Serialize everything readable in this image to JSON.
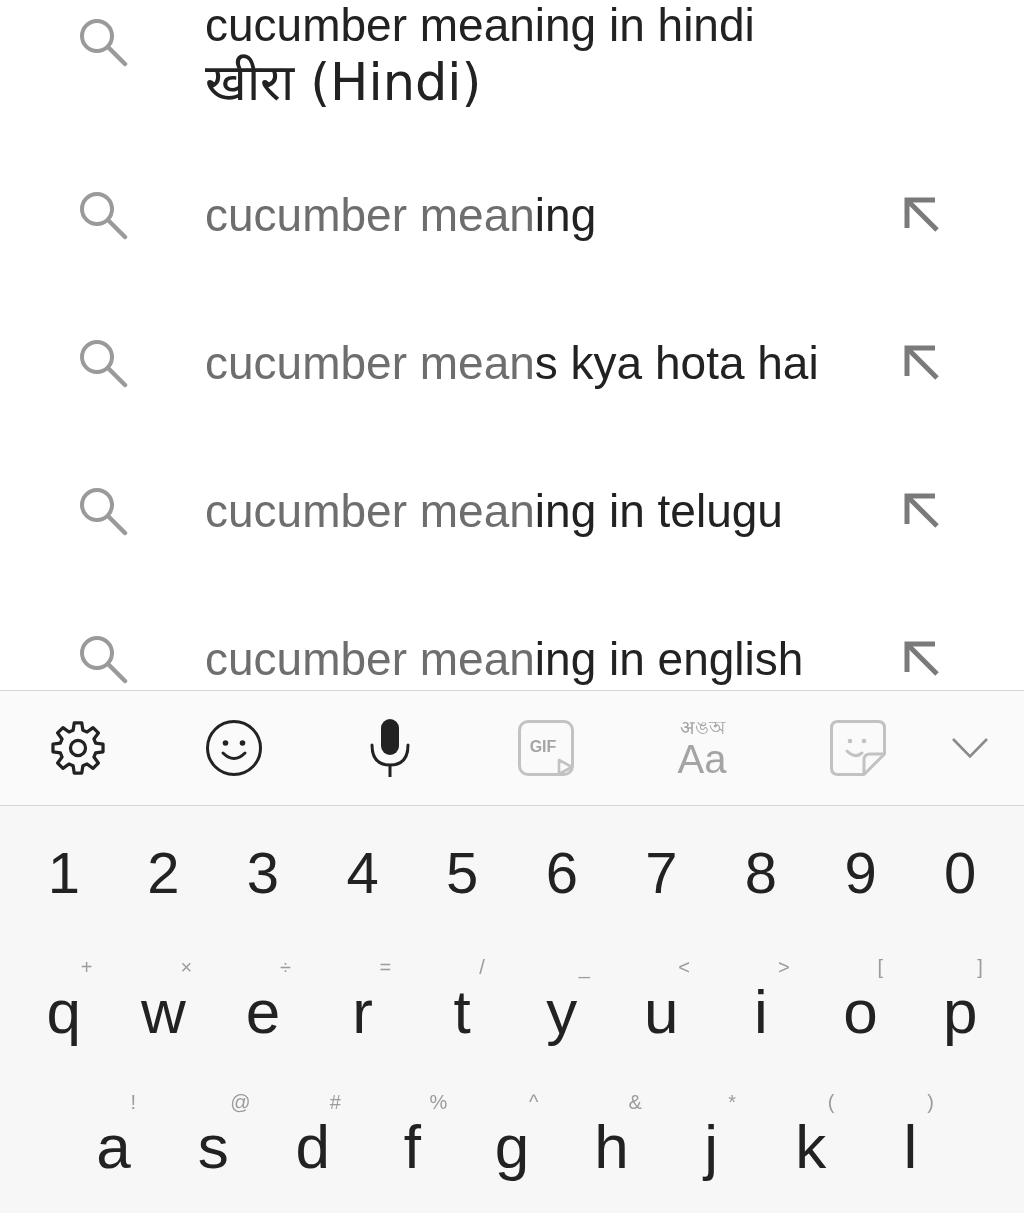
{
  "suggestions": [
    {
      "kind": "answer",
      "lines": [
        "cucumber meaning in hindi",
        "खीरा (Hindi)"
      ]
    },
    {
      "kind": "query",
      "typed": "cucumber mean",
      "completion": "ing"
    },
    {
      "kind": "query",
      "typed": "cucumber mean",
      "completion": "s kya hota hai"
    },
    {
      "kind": "query",
      "typed": "cucumber mean",
      "completion": "ing in telugu"
    },
    {
      "kind": "query",
      "typed": "cucumber mean",
      "completion": "ing in english"
    }
  ],
  "toolbar": [
    {
      "kind": "settings",
      "disabled": false
    },
    {
      "kind": "emoji",
      "disabled": false
    },
    {
      "kind": "voice",
      "disabled": false
    },
    {
      "kind": "gif",
      "label": "GIF",
      "disabled": true
    },
    {
      "kind": "script",
      "script": "अঙঅ",
      "label": "Aa",
      "disabled": true
    },
    {
      "kind": "sticker",
      "disabled": true
    },
    {
      "kind": "collapse",
      "disabled": false
    }
  ],
  "keyboard": {
    "rows": [
      {
        "keys": [
          {
            "label": "1"
          },
          {
            "label": "2"
          },
          {
            "label": "3"
          },
          {
            "label": "4"
          },
          {
            "label": "5"
          },
          {
            "label": "6"
          },
          {
            "label": "7"
          },
          {
            "label": "8"
          },
          {
            "label": "9"
          },
          {
            "label": "0"
          }
        ]
      },
      {
        "keys": [
          {
            "label": "q",
            "hint": "+"
          },
          {
            "label": "w",
            "hint": "×"
          },
          {
            "label": "e",
            "hint": "÷"
          },
          {
            "label": "r",
            "hint": "="
          },
          {
            "label": "t",
            "hint": "/"
          },
          {
            "label": "y",
            "hint": "_"
          },
          {
            "label": "u",
            "hint": "<"
          },
          {
            "label": "i",
            "hint": ">"
          },
          {
            "label": "o",
            "hint": "["
          },
          {
            "label": "p",
            "hint": "]"
          }
        ]
      },
      {
        "keys": [
          {
            "label": "a",
            "hint": "!"
          },
          {
            "label": "s",
            "hint": "@"
          },
          {
            "label": "d",
            "hint": "#"
          },
          {
            "label": "f",
            "hint": "%"
          },
          {
            "label": "g",
            "hint": "^"
          },
          {
            "label": "h",
            "hint": "&"
          },
          {
            "label": "j",
            "hint": "*"
          },
          {
            "label": "k",
            "hint": "("
          },
          {
            "label": "l",
            "hint": ")"
          }
        ]
      }
    ]
  }
}
